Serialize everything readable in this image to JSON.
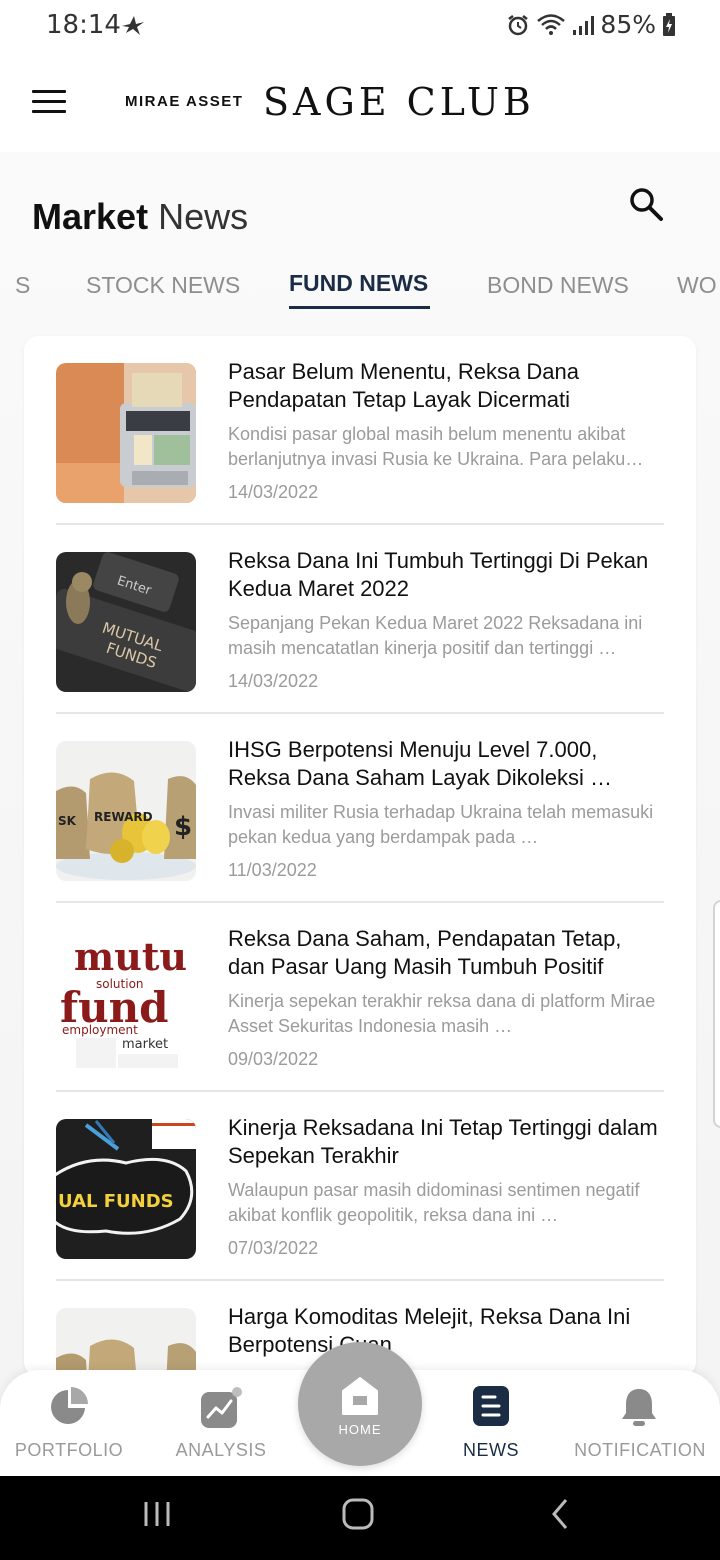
{
  "status_bar": {
    "time": "18:14",
    "battery": "85%"
  },
  "header": {
    "brand_small": "MIRAE ASSET",
    "brand_big": "SAGE CLUB"
  },
  "page": {
    "title_bold": "Market",
    "title_light": "News"
  },
  "tabs": [
    {
      "label": "S"
    },
    {
      "label": "STOCK NEWS"
    },
    {
      "label": "FUND NEWS",
      "active": true
    },
    {
      "label": "BOND NEWS"
    },
    {
      "label": "WO"
    }
  ],
  "news": [
    {
      "title": "Pasar Belum Menentu, Reksa Dana Pendapatan Tetap Layak Dicermati",
      "summary": "Kondisi pasar global masih belum menentu akibat berlanjutnya invasi Rusia ke Ukraina. Para pelaku…",
      "date": "14/03/2022"
    },
    {
      "title": "Reksa Dana Ini Tumbuh Tertinggi Di Pekan Kedua Maret 2022",
      "summary": "Sepanjang Pekan Kedua Maret 2022 Reksadana ini masih mencatatlan kinerja positif dan tertinggi …",
      "date": "14/03/2022",
      "thumb_text_1": "Enter",
      "thumb_text_2": "MUTUAL",
      "thumb_text_3": "FUNDS"
    },
    {
      "title": "IHSG Berpotensi Menuju Level 7.000, Reksa Dana Saham Layak Dikoleksi …",
      "summary": "Invasi militer Rusia terhadap Ukraina telah memasuki pekan kedua yang berdampak pada …",
      "date": "11/03/2022",
      "thumb_text_1": "SK",
      "thumb_text_2": "REWARD",
      "thumb_text_3": "$"
    },
    {
      "title": "Reksa Dana Saham, Pendapatan Tetap, dan Pasar Uang Masih Tumbuh Positif",
      "summary": "Kinerja sepekan terakhir reksa dana di platform Mirae Asset Sekuritas Indonesia masih …",
      "date": "09/03/2022",
      "thumb_text_1": "mutu",
      "thumb_text_2": "fund",
      "thumb_text_3": "employment",
      "thumb_text_4": "market",
      "thumb_text_5": "solution"
    },
    {
      "title": "Kinerja Reksadana Ini Tetap Tertinggi dalam Sepekan Terakhir",
      "summary": "Walaupun pasar masih didominasi sentimen negatif akibat konflik geopolitik, reksa dana ini …",
      "date": "07/03/2022",
      "thumb_text_1": "UAL FUNDS"
    },
    {
      "title": "Harga Komoditas Melejit, Reksa Dana Ini Berpotensi Cuan",
      "summary": "",
      "date": ""
    }
  ],
  "bottom_nav": {
    "portfolio": "PORTFOLIO",
    "analysis": "ANALYSIS",
    "home": "HOME",
    "news": "NEWS",
    "notification": "NOTIFICATION"
  },
  "colors": {
    "accent_navy": "#1b2d45",
    "inactive_gray": "#8e8e8e",
    "home_fab": "#a8a8a8"
  }
}
